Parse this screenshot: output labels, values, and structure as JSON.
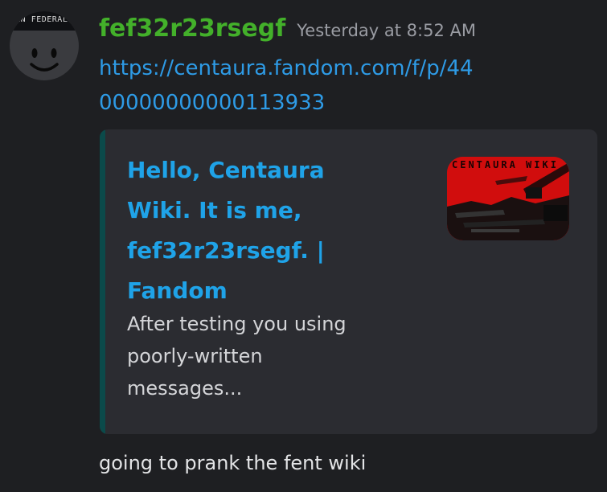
{
  "message": {
    "avatar_text": "SAN FEDERAL N",
    "username": "fef32r23rsegf",
    "timestamp": "Yesterday at 8:52 AM",
    "link_text": "https://centaura.fandom.com/f/p/4400000000000113933",
    "body": "going to prank the fent wiki"
  },
  "embed": {
    "title": "Hello, Centaura Wiki. It is me, fef32r23rsegf. | Fandom",
    "description": "After testing you using poorly-written messages...",
    "thumbnail_text": "CENTAURA WIKI",
    "accent_color": "#0b4a4a"
  },
  "colors": {
    "username": "#43b02a",
    "link": "#2e9be6",
    "embed_title": "#1fa3e8",
    "background": "#1e1f22",
    "embed_background": "#2b2c31"
  }
}
